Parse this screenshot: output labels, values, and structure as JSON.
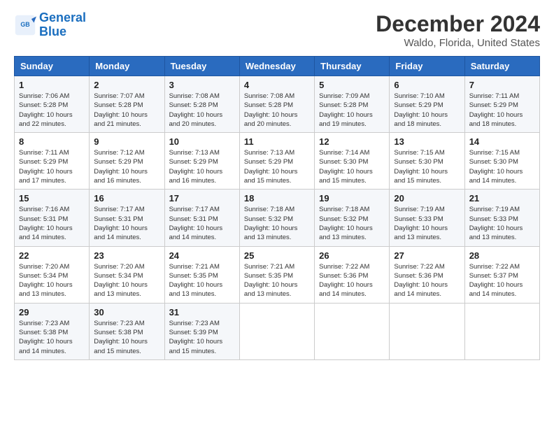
{
  "logo": {
    "line1": "General",
    "line2": "Blue"
  },
  "header": {
    "month": "December 2024",
    "location": "Waldo, Florida, United States"
  },
  "days_of_week": [
    "Sunday",
    "Monday",
    "Tuesday",
    "Wednesday",
    "Thursday",
    "Friday",
    "Saturday"
  ],
  "weeks": [
    [
      {
        "day": "1",
        "sunrise": "7:06 AM",
        "sunset": "5:28 PM",
        "daylight": "10 hours and 22 minutes."
      },
      {
        "day": "2",
        "sunrise": "7:07 AM",
        "sunset": "5:28 PM",
        "daylight": "10 hours and 21 minutes."
      },
      {
        "day": "3",
        "sunrise": "7:08 AM",
        "sunset": "5:28 PM",
        "daylight": "10 hours and 20 minutes."
      },
      {
        "day": "4",
        "sunrise": "7:08 AM",
        "sunset": "5:28 PM",
        "daylight": "10 hours and 20 minutes."
      },
      {
        "day": "5",
        "sunrise": "7:09 AM",
        "sunset": "5:28 PM",
        "daylight": "10 hours and 19 minutes."
      },
      {
        "day": "6",
        "sunrise": "7:10 AM",
        "sunset": "5:29 PM",
        "daylight": "10 hours and 18 minutes."
      },
      {
        "day": "7",
        "sunrise": "7:11 AM",
        "sunset": "5:29 PM",
        "daylight": "10 hours and 18 minutes."
      }
    ],
    [
      {
        "day": "8",
        "sunrise": "7:11 AM",
        "sunset": "5:29 PM",
        "daylight": "10 hours and 17 minutes."
      },
      {
        "day": "9",
        "sunrise": "7:12 AM",
        "sunset": "5:29 PM",
        "daylight": "10 hours and 16 minutes."
      },
      {
        "day": "10",
        "sunrise": "7:13 AM",
        "sunset": "5:29 PM",
        "daylight": "10 hours and 16 minutes."
      },
      {
        "day": "11",
        "sunrise": "7:13 AM",
        "sunset": "5:29 PM",
        "daylight": "10 hours and 15 minutes."
      },
      {
        "day": "12",
        "sunrise": "7:14 AM",
        "sunset": "5:30 PM",
        "daylight": "10 hours and 15 minutes."
      },
      {
        "day": "13",
        "sunrise": "7:15 AM",
        "sunset": "5:30 PM",
        "daylight": "10 hours and 15 minutes."
      },
      {
        "day": "14",
        "sunrise": "7:15 AM",
        "sunset": "5:30 PM",
        "daylight": "10 hours and 14 minutes."
      }
    ],
    [
      {
        "day": "15",
        "sunrise": "7:16 AM",
        "sunset": "5:31 PM",
        "daylight": "10 hours and 14 minutes."
      },
      {
        "day": "16",
        "sunrise": "7:17 AM",
        "sunset": "5:31 PM",
        "daylight": "10 hours and 14 minutes."
      },
      {
        "day": "17",
        "sunrise": "7:17 AM",
        "sunset": "5:31 PM",
        "daylight": "10 hours and 14 minutes."
      },
      {
        "day": "18",
        "sunrise": "7:18 AM",
        "sunset": "5:32 PM",
        "daylight": "10 hours and 13 minutes."
      },
      {
        "day": "19",
        "sunrise": "7:18 AM",
        "sunset": "5:32 PM",
        "daylight": "10 hours and 13 minutes."
      },
      {
        "day": "20",
        "sunrise": "7:19 AM",
        "sunset": "5:33 PM",
        "daylight": "10 hours and 13 minutes."
      },
      {
        "day": "21",
        "sunrise": "7:19 AM",
        "sunset": "5:33 PM",
        "daylight": "10 hours and 13 minutes."
      }
    ],
    [
      {
        "day": "22",
        "sunrise": "7:20 AM",
        "sunset": "5:34 PM",
        "daylight": "10 hours and 13 minutes."
      },
      {
        "day": "23",
        "sunrise": "7:20 AM",
        "sunset": "5:34 PM",
        "daylight": "10 hours and 13 minutes."
      },
      {
        "day": "24",
        "sunrise": "7:21 AM",
        "sunset": "5:35 PM",
        "daylight": "10 hours and 13 minutes."
      },
      {
        "day": "25",
        "sunrise": "7:21 AM",
        "sunset": "5:35 PM",
        "daylight": "10 hours and 13 minutes."
      },
      {
        "day": "26",
        "sunrise": "7:22 AM",
        "sunset": "5:36 PM",
        "daylight": "10 hours and 14 minutes."
      },
      {
        "day": "27",
        "sunrise": "7:22 AM",
        "sunset": "5:36 PM",
        "daylight": "10 hours and 14 minutes."
      },
      {
        "day": "28",
        "sunrise": "7:22 AM",
        "sunset": "5:37 PM",
        "daylight": "10 hours and 14 minutes."
      }
    ],
    [
      {
        "day": "29",
        "sunrise": "7:23 AM",
        "sunset": "5:38 PM",
        "daylight": "10 hours and 14 minutes."
      },
      {
        "day": "30",
        "sunrise": "7:23 AM",
        "sunset": "5:38 PM",
        "daylight": "10 hours and 15 minutes."
      },
      {
        "day": "31",
        "sunrise": "7:23 AM",
        "sunset": "5:39 PM",
        "daylight": "10 hours and 15 minutes."
      },
      null,
      null,
      null,
      null
    ]
  ]
}
